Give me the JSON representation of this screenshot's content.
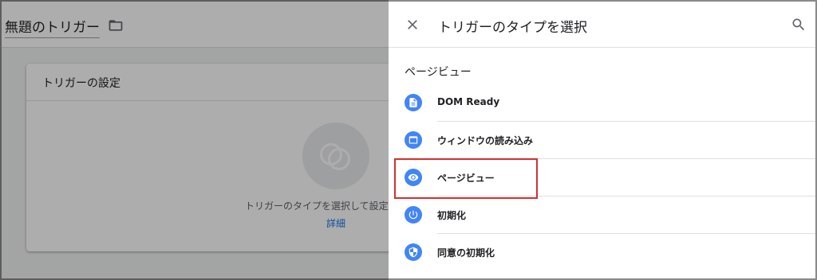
{
  "background": {
    "trigger_name": "無題のトリガー",
    "card": {
      "title": "トリガーの設定",
      "hint": "トリガーのタイプを選択して設定",
      "link": "詳細"
    }
  },
  "panel": {
    "title": "トリガーのタイプを選択",
    "section_heading": "ページビュー",
    "items": [
      {
        "label": "DOM Ready",
        "icon": "document-icon"
      },
      {
        "label": "ウィンドウの読み込み",
        "icon": "window-icon"
      },
      {
        "label": "ページビュー",
        "icon": "eye-icon"
      },
      {
        "label": "初期化",
        "icon": "power-icon"
      },
      {
        "label": "同意の初期化",
        "icon": "shield-icon"
      }
    ],
    "highlighted_item": "ページビュー"
  },
  "colors": {
    "accent": "#4285f4",
    "link": "#1a73e8",
    "highlight": "#d32f2f",
    "overlay": "rgba(0,0,0,0.32)"
  }
}
